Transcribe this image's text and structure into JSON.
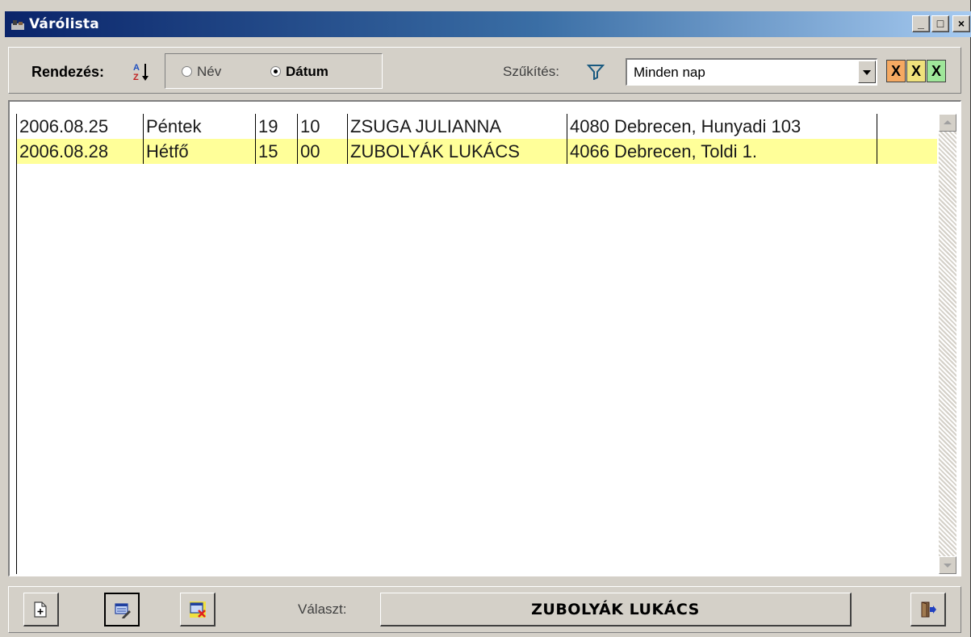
{
  "window": {
    "title": "Várólista",
    "controls": {
      "minimize": "_",
      "maximize": "□",
      "close": "×"
    }
  },
  "toolbar": {
    "sort_label": "Rendezés:",
    "sort_icon": "sort-az-icon",
    "radio_name": "Név",
    "radio_date": "Dátum",
    "selected_sort": "Dátum",
    "filter_label": "Szűkítés:",
    "filter_icon": "funnel-icon",
    "filter_value": "Minden nap",
    "x_buttons": [
      "X",
      "X",
      "X"
    ],
    "x_colors": [
      "#f5a962",
      "#f0e27c",
      "#9fe79a"
    ]
  },
  "list": {
    "rows": [
      {
        "date": "2006.08.25",
        "day": "Péntek",
        "hour": "19",
        "minute": "10",
        "name": "ZSUGA JULIANNA",
        "address": "4080 Debrecen, Hunyadi 103",
        "extra": ""
      },
      {
        "date": "2006.08.28",
        "day": "Hétfő",
        "hour": "15",
        "minute": "00",
        "name": "ZUBOLYÁK LUKÁCS",
        "address": "4066 Debrecen, Toldi 1.",
        "extra": ""
      }
    ],
    "selected_row_index": 1,
    "selected_row_color": "#ffff99"
  },
  "bottombar": {
    "select_label": "Választ:",
    "selected_name": "ZUBOLYÁK LUKÁCS",
    "buttons": [
      "new-record-icon",
      "edit-record-icon",
      "delete-record-icon",
      "exit-door-icon"
    ]
  }
}
